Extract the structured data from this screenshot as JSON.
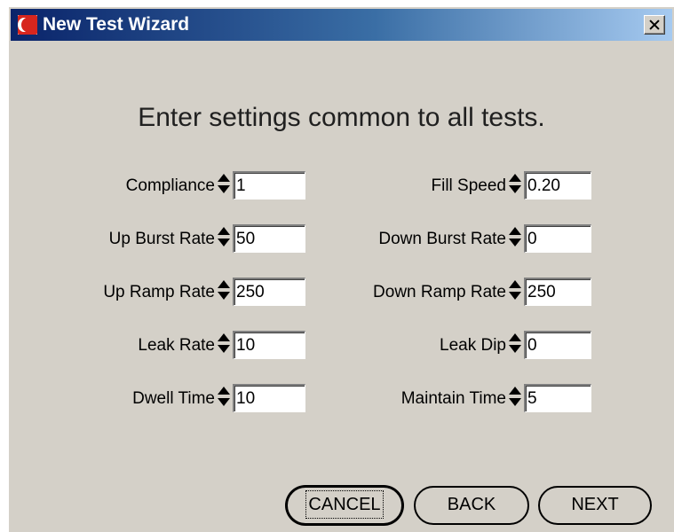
{
  "window": {
    "title": "New Test Wizard",
    "close_label": "×"
  },
  "heading": "Enter settings common to all tests.",
  "fields": {
    "compliance": {
      "label": "Compliance",
      "value": "1"
    },
    "fill_speed": {
      "label": "Fill Speed",
      "value": "0.20"
    },
    "up_burst_rate": {
      "label": "Up Burst Rate",
      "value": "50"
    },
    "down_burst_rate": {
      "label": "Down Burst Rate",
      "value": "0"
    },
    "up_ramp_rate": {
      "label": "Up Ramp Rate",
      "value": "250"
    },
    "down_ramp_rate": {
      "label": "Down Ramp Rate",
      "value": "250"
    },
    "leak_rate": {
      "label": "Leak Rate",
      "value": "10"
    },
    "leak_dip": {
      "label": "Leak Dip",
      "value": "0"
    },
    "dwell_time": {
      "label": "Dwell Time",
      "value": "10"
    },
    "maintain_time": {
      "label": "Maintain Time",
      "value": "5"
    }
  },
  "buttons": {
    "cancel": "CANCEL",
    "back": "BACK",
    "next": "NEXT"
  },
  "colors": {
    "titlebar_start": "#0a246a",
    "titlebar_end": "#a6caf0",
    "dialog_bg": "#d4d0c8"
  }
}
